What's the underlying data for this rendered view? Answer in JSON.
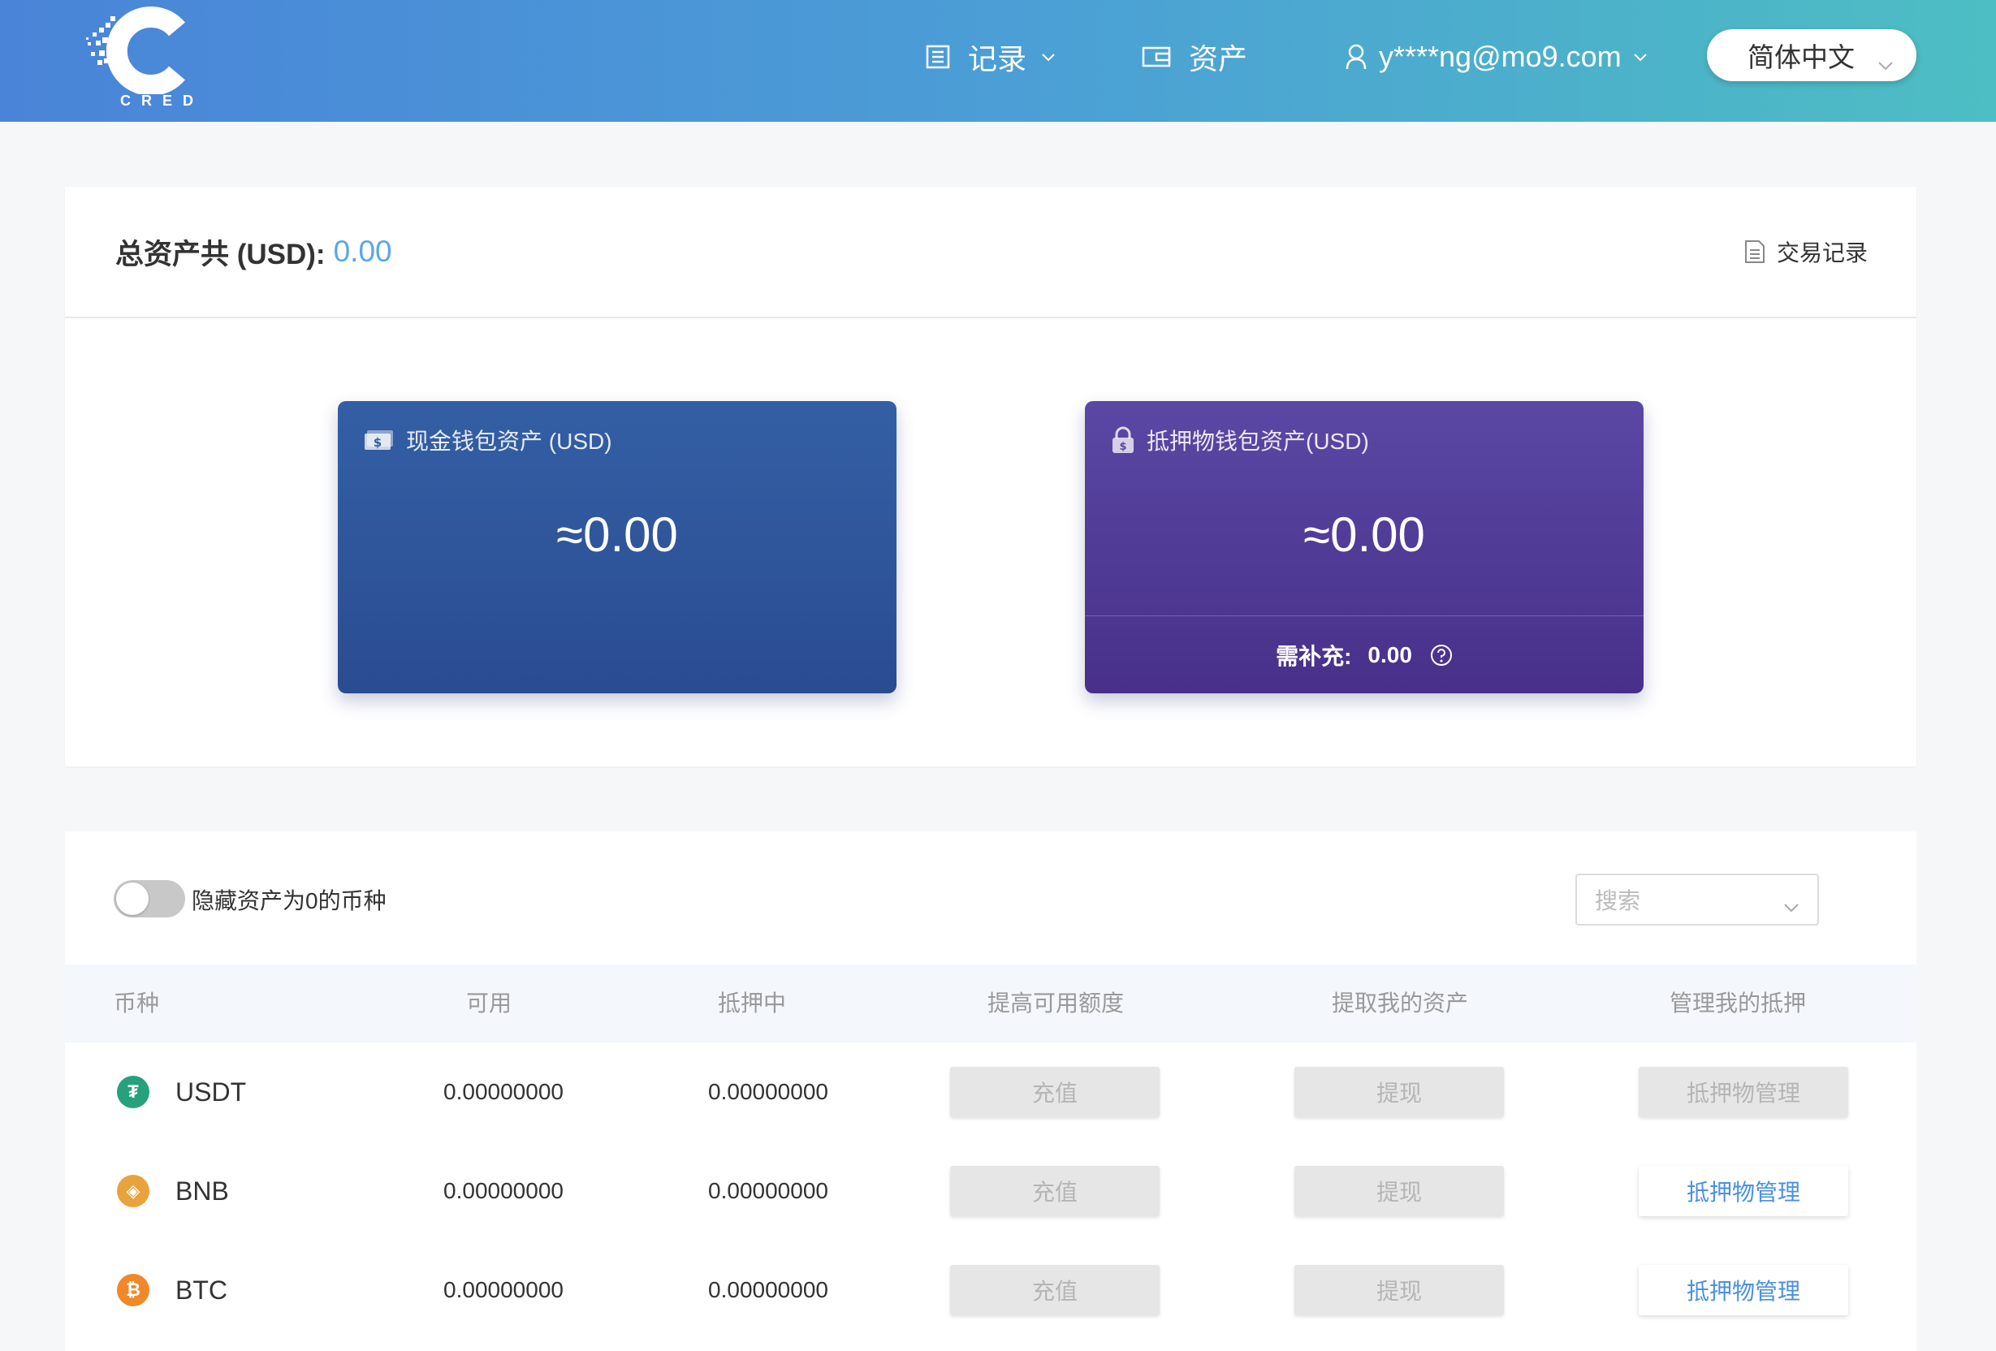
{
  "header": {
    "logo_text": "CRED",
    "nav": {
      "records_label": "记录",
      "assets_label": "资产",
      "user_email": "y****ng@mo9.com"
    },
    "language": "简体中文"
  },
  "summary": {
    "total_label": "总资产共 (USD):",
    "total_value": "0.00",
    "tx_link_label": "交易记录"
  },
  "wallets": {
    "cash": {
      "title": "现金钱包资产 (USD)",
      "amount": "≈0.00"
    },
    "collateral": {
      "title": "抵押物钱包资产(USD)",
      "amount": "≈0.00",
      "required_label": "需补充:",
      "required_value": "0.00"
    }
  },
  "assets_table": {
    "hide_zero_label": "隐藏资产为0的币种",
    "hide_zero_enabled": false,
    "search_placeholder": "搜索",
    "columns": [
      "币种",
      "可用",
      "抵押中",
      "提高可用额度",
      "提取我的资产",
      "管理我的抵押"
    ],
    "rows": [
      {
        "coin": "USDT",
        "available": "0.00000000",
        "pledged": "0.00000000",
        "deposit": "充值",
        "withdraw": "提现",
        "manage": "抵押物管理",
        "manage_enabled": false,
        "icon_color": "#26a17b",
        "icon_glyph": "₮"
      },
      {
        "coin": "BNB",
        "available": "0.00000000",
        "pledged": "0.00000000",
        "deposit": "充值",
        "withdraw": "提现",
        "manage": "抵押物管理",
        "manage_enabled": true,
        "icon_color": "#e8a33d",
        "icon_glyph": "◈"
      },
      {
        "coin": "BTC",
        "available": "0.00000000",
        "pledged": "0.00000000",
        "deposit": "充值",
        "withdraw": "提现",
        "manage": "抵押物管理",
        "manage_enabled": true,
        "icon_color": "#f0882a",
        "icon_glyph": "₿"
      }
    ]
  }
}
